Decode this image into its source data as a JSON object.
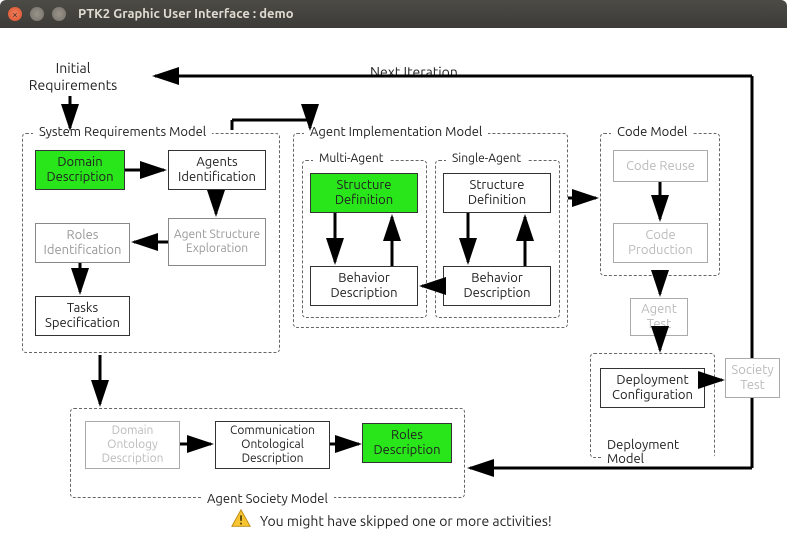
{
  "window": {
    "title": "PTK2 Graphic User Interface : demo"
  },
  "labels": {
    "initial_requirements": "Initial Requirements",
    "next_iteration": "Next Iteration"
  },
  "groups": {
    "srm": "System Requirements Model",
    "aim": "Agent Implementation Model",
    "ma": "Multi-Agent",
    "sa": "Single-Agent",
    "cm": "Code Model",
    "dm": "Deployment Model",
    "asm": "Agent Society  Model"
  },
  "nodes": {
    "domain_description": "Domain Description",
    "agents_identification": "Agents Identification",
    "roles_identification": "Roles Identification",
    "agent_structure_exploration": "Agent Structure Exploration",
    "tasks_specification": "Tasks Specification",
    "ma_structure_definition": "Structure Definition",
    "ma_behavior_description": "Behavior Description",
    "sa_structure_definition": "Structure Definition",
    "sa_behavior_description": "Behavior Description",
    "code_reuse": "Code Reuse",
    "code_production": "Code Production",
    "agent_test": "Agent Test",
    "deployment_configuration": "Deployment Configuration",
    "society_test": "Society Test",
    "domain_ontology_description": "Domain Ontology Description",
    "communication_ontological_description": "Communication Ontological Description",
    "roles_description": "Roles Description"
  },
  "warning": "You might have skipped one or more activities!",
  "colors": {
    "highlight": "#28e61a"
  }
}
